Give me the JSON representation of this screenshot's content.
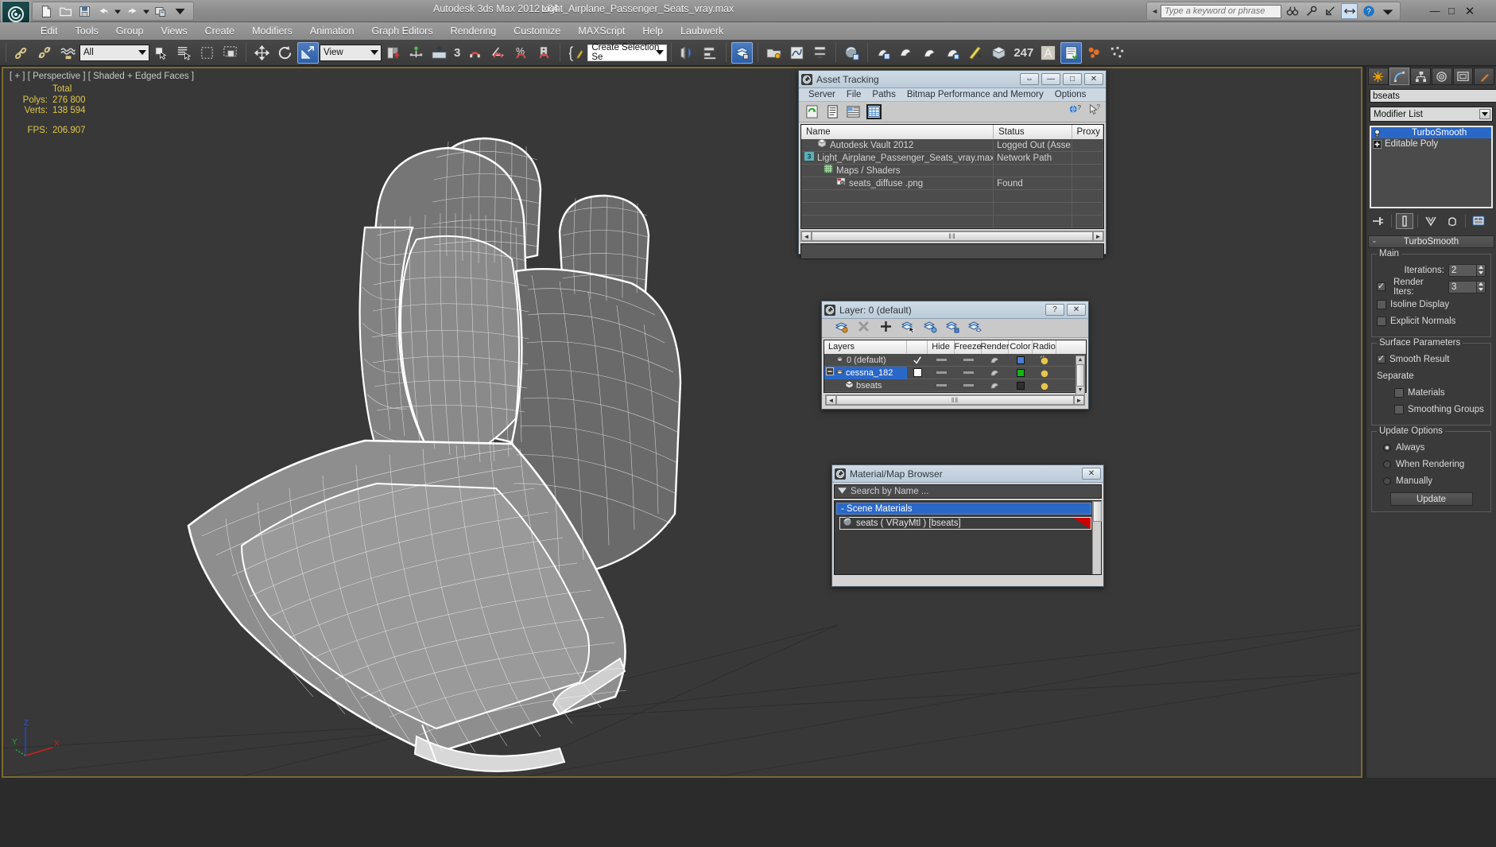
{
  "titlebar": {
    "app_title": "Autodesk 3ds Max  2012 x64",
    "file_title": "Light_Airplane_Passenger_Seats_vray.max",
    "search_placeholder": "Type a keyword or phrase",
    "search_value": "",
    "minimize": "—",
    "maximize": "□",
    "close": "✕"
  },
  "menubar": {
    "items": [
      {
        "label": "Edit"
      },
      {
        "label": "Tools"
      },
      {
        "label": "Group"
      },
      {
        "label": "Views"
      },
      {
        "label": "Create"
      },
      {
        "label": "Modifiers"
      },
      {
        "label": "Animation"
      },
      {
        "label": "Graph Editors"
      },
      {
        "label": "Rendering"
      },
      {
        "label": "Customize"
      },
      {
        "label": "MAXScript"
      },
      {
        "label": "Help"
      },
      {
        "label": "Laubwerk"
      }
    ]
  },
  "toolbar": {
    "selection_filter": "All",
    "ref_coord_system": "View",
    "named_selection_set": "Create Selection Se",
    "snap_toggle_value": "3",
    "render_frame_value": "247"
  },
  "viewport": {
    "label": "[ + ] [ Perspective ] [ Shaded + Edged Faces ]",
    "stats_header": "Total",
    "polys_label": "Polys:",
    "polys_value": "276 800",
    "verts_label": "Verts:",
    "verts_value": "138 594",
    "fps_label": "FPS:",
    "fps_value": "206.907",
    "axis_x": "X",
    "axis_y": "Y",
    "axis_z": "Z"
  },
  "command_panel": {
    "tabs": [
      "create-tab",
      "modify-tab",
      "hierarchy-tab",
      "motion-tab",
      "display-tab",
      "utilities-tab"
    ],
    "object_name": "bseats",
    "modifier_list_label": "Modifier List",
    "modifier_stack": [
      {
        "label": "TurboSmooth",
        "selected": true
      },
      {
        "label": "Editable Poly",
        "selected": false
      }
    ],
    "turbosmooth": {
      "rollout_title": "TurboSmooth",
      "collapse_glyph": "-",
      "main_group": "Main",
      "iterations_label": "Iterations:",
      "iterations_value": "2",
      "render_iters_label": "Render Iters:",
      "render_iters_checked": true,
      "render_iters_value": "3",
      "isoline_display_label": "Isoline Display",
      "isoline_display_checked": false,
      "explicit_normals_label": "Explicit Normals",
      "explicit_normals_checked": false,
      "surface_group": "Surface Parameters",
      "smooth_result_label": "Smooth Result",
      "smooth_result_checked": true,
      "separate_label": "Separate",
      "materials_label": "Materials",
      "materials_checked": false,
      "smoothing_groups_label": "Smoothing Groups",
      "smoothing_groups_checked": false,
      "update_group": "Update Options",
      "always_label": "Always",
      "when_rendering_label": "When Rendering",
      "manually_label": "Manually",
      "update_selected": "Always",
      "update_button": "Update"
    }
  },
  "asset_tracking": {
    "title": "Asset Tracking",
    "close_glyph": "✕",
    "restore_glyph": "⇔",
    "minimize_glyph": "—",
    "maximize_glyph": "□",
    "menu": [
      "Server",
      "File",
      "Paths",
      "Bitmap Performance and Memory",
      "Options"
    ],
    "columns": [
      "Name",
      "Status",
      "Proxy"
    ],
    "rows": [
      {
        "indent": 0,
        "icon": "vault-icon",
        "name": "Autodesk Vault 2012",
        "status": "Logged Out (Asse...",
        "proxy": ""
      },
      {
        "indent": 1,
        "icon": "maxfile-icon",
        "name": "Light_Airplane_Passenger_Seats_vray.max",
        "status": "Network Path",
        "proxy": ""
      },
      {
        "indent": 1,
        "icon": "maps-icon",
        "name": "Maps / Shaders",
        "status": "",
        "proxy": ""
      },
      {
        "indent": 2,
        "icon": "bitmap-icon",
        "name": "seats_diffuse .png",
        "status": "Found",
        "proxy": ""
      },
      {
        "indent": 0,
        "icon": "",
        "name": "",
        "status": "",
        "proxy": ""
      },
      {
        "indent": 0,
        "icon": "",
        "name": "",
        "status": "",
        "proxy": ""
      },
      {
        "indent": 0,
        "icon": "",
        "name": "",
        "status": "",
        "proxy": ""
      }
    ],
    "scroll_left": "◄",
    "scroll_right": "►",
    "scroll_grip": "‖‖"
  },
  "layer_window": {
    "title": "Layer: 0 (default)",
    "help_glyph": "?",
    "close_glyph": "✕",
    "columns": [
      "Layers",
      "",
      "Hide",
      "Freeze",
      "Render",
      "Color",
      "Radio"
    ],
    "rows": [
      {
        "name": "0 (default)",
        "icon": "layer-icon",
        "indent": 0,
        "current": true,
        "selected": false,
        "color": "#4a7fd4"
      },
      {
        "name": "cessna_182",
        "icon": "layer-icon",
        "indent": 0,
        "current": false,
        "selected": true,
        "color": "#13b513"
      },
      {
        "name": "bseats",
        "icon": "object-icon",
        "indent": 1,
        "current": false,
        "selected": false,
        "color": "#3a3a3a"
      }
    ],
    "scroll_grip": "‖‖",
    "scroll_left": "◄",
    "scroll_right": "►",
    "scroll_up": "▲",
    "scroll_down": "▼"
  },
  "material_browser": {
    "title": "Material/Map Browser",
    "close_glyph": "✕",
    "search_placeholder": "Search by Name ...",
    "group_label": "Scene Materials",
    "group_collapse": "-",
    "items": [
      {
        "label": "seats  ( VRayMtl )  [bseats]",
        "has_red_corner": true
      }
    ]
  }
}
